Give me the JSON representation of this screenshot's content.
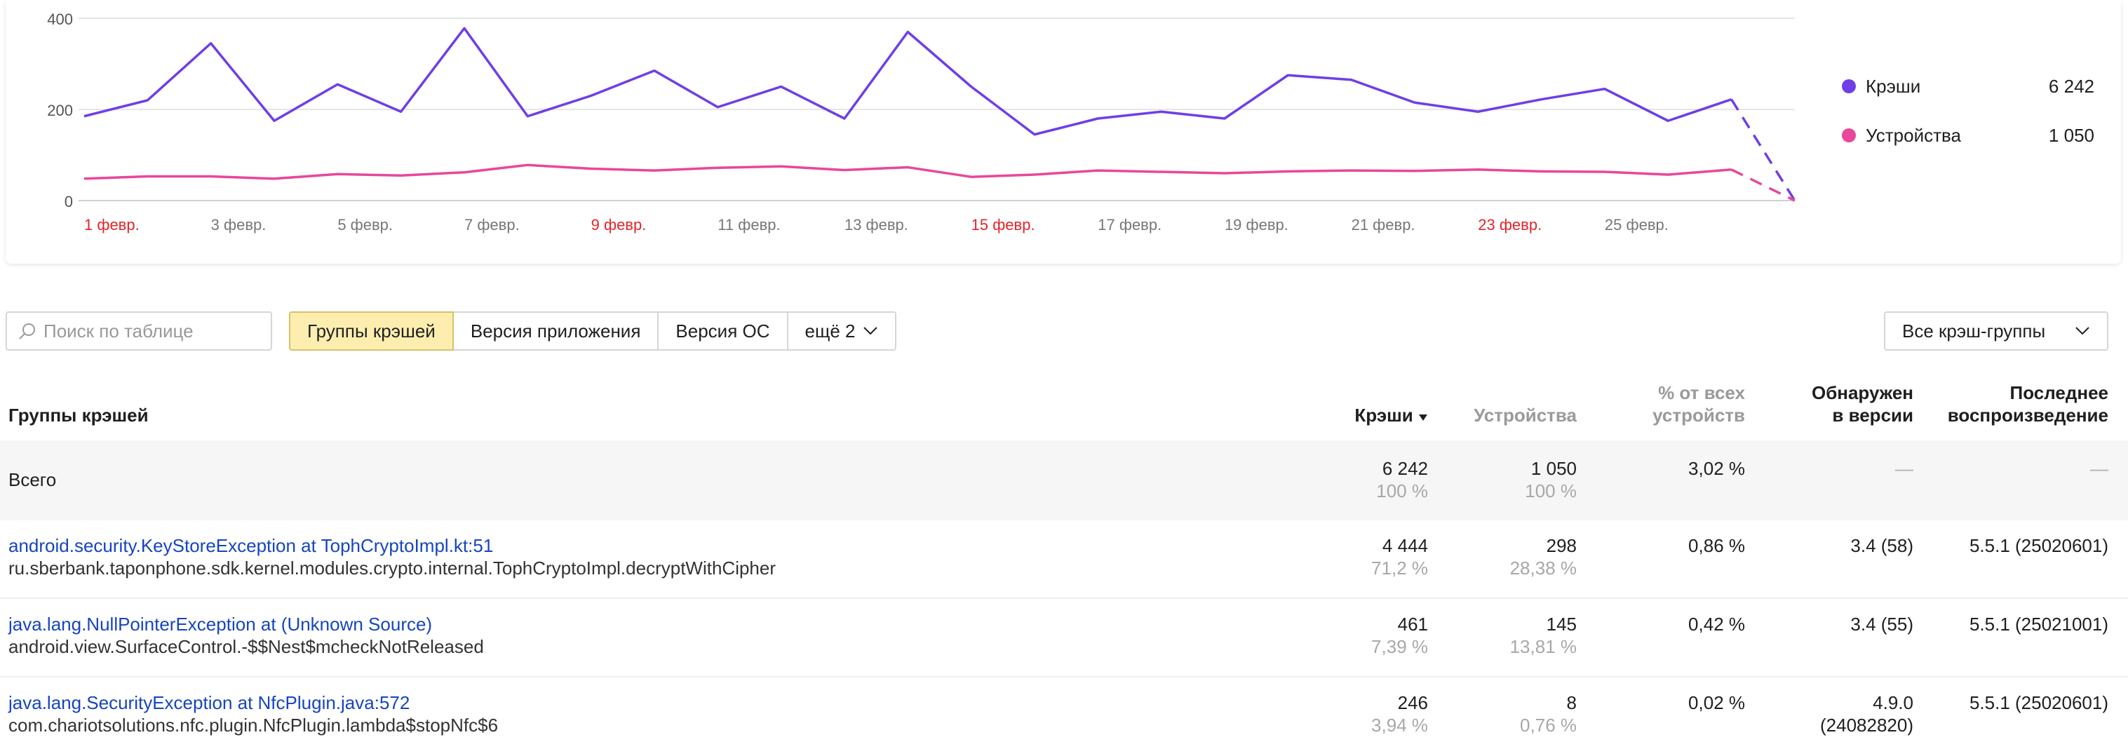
{
  "chart_data": {
    "type": "line",
    "x": [
      "1 февр.",
      "2 февр.",
      "3 февр.",
      "4 февр.",
      "5 февр.",
      "6 февр.",
      "7 февр.",
      "8 февр.",
      "9 февр.",
      "10 февр.",
      "11 февр.",
      "12 февр.",
      "13 февр.",
      "14 февр.",
      "15 февр.",
      "16 февр.",
      "17 февр.",
      "18 февр.",
      "19 февр.",
      "20 февр.",
      "21 февр.",
      "22 февр.",
      "23 февр.",
      "24 февр.",
      "25 февр.",
      "26 февр.",
      "27 февр.",
      "28 февр."
    ],
    "x_tick_labels": [
      {
        "label": "1 февр.",
        "weekend": true
      },
      {
        "label": "3 февр.",
        "weekend": false
      },
      {
        "label": "5 февр.",
        "weekend": false
      },
      {
        "label": "7 февр.",
        "weekend": false
      },
      {
        "label": "9 февр.",
        "weekend": true
      },
      {
        "label": "11 февр.",
        "weekend": false
      },
      {
        "label": "13 февр.",
        "weekend": false
      },
      {
        "label": "15 февр.",
        "weekend": true
      },
      {
        "label": "17 февр.",
        "weekend": false
      },
      {
        "label": "19 февр.",
        "weekend": false
      },
      {
        "label": "21 февр.",
        "weekend": false
      },
      {
        "label": "23 февр.",
        "weekend": true
      },
      {
        "label": "25 февр.",
        "weekend": false
      }
    ],
    "y_ticks": [
      "0",
      "200",
      "400"
    ],
    "ylim": [
      0,
      400
    ],
    "grid": true,
    "series": [
      {
        "name": "Крэши",
        "color": "#6e3fe6",
        "values": [
          185,
          220,
          345,
          175,
          255,
          195,
          378,
          185,
          230,
          285,
          205,
          250,
          180,
          370,
          250,
          145,
          180,
          195,
          180,
          275,
          265,
          215,
          195,
          222,
          245,
          175,
          222,
          0
        ]
      },
      {
        "name": "Устройства",
        "color": "#e8479a",
        "values": [
          48,
          53,
          53,
          48,
          58,
          55,
          62,
          78,
          70,
          66,
          72,
          75,
          67,
          73,
          52,
          57,
          66,
          63,
          60,
          64,
          66,
          65,
          68,
          64,
          63,
          57,
          68,
          0
        ]
      }
    ],
    "last_point_dashed": true,
    "legend_placement": "right"
  },
  "colors": {
    "crashes": "#6e3fe6",
    "devices": "#e8479a",
    "weekend": "#e3242b",
    "link": "#1745bd",
    "active_tab": "#fdeeb0"
  },
  "legend": [
    {
      "label": "Крэши",
      "value": "6 242",
      "color": "#6e3fe6"
    },
    {
      "label": "Устройства",
      "value": "1 050",
      "color": "#e8479a"
    }
  ],
  "toolbar": {
    "search_placeholder": "Поиск по таблице",
    "tabs": [
      "Группы крэшей",
      "Версия приложения",
      "Версия ОС",
      "ещё 2"
    ],
    "active_tab": "Группы крэшей",
    "group_filter": "Все крэш-группы"
  },
  "table": {
    "headers": {
      "group": "Группы крэшей",
      "crashes": "Крэши",
      "devices": "Устройства",
      "percent_line1": "% от всех",
      "percent_line2": "устройств",
      "found_line1": "Обнаружен",
      "found_line2": "в версии",
      "last_line1": "Последнее",
      "last_line2": "воспроизведение"
    },
    "total": {
      "label": "Всего",
      "crashes": "6 242",
      "crashes_pct": "100 %",
      "devices": "1 050",
      "devices_pct": "100 %",
      "percent": "3,02 %",
      "found": "—",
      "last": "—"
    },
    "rows": [
      {
        "title": "android.security.KeyStoreException at TophCryptoImpl.kt:51",
        "subtitle": "ru.sberbank.taponphone.sdk.kernel.modules.crypto.internal.TophCryptoImpl.decryptWithCipher",
        "crashes": "4 444",
        "crashes_pct": "71,2 %",
        "devices": "298",
        "devices_pct": "28,38 %",
        "percent": "0,86 %",
        "found_line1": "3.4 (58)",
        "found_line2": "",
        "last": "5.5.1 (25020601)"
      },
      {
        "title": "java.lang.NullPointerException at (Unknown Source)",
        "subtitle": "android.view.SurfaceControl.-$$Nest$mcheckNotReleased",
        "crashes": "461",
        "crashes_pct": "7,39 %",
        "devices": "145",
        "devices_pct": "13,81 %",
        "percent": "0,42 %",
        "found_line1": "3.4 (55)",
        "found_line2": "",
        "last": "5.5.1 (25021001)"
      },
      {
        "title": "java.lang.SecurityException at NfcPlugin.java:572",
        "subtitle": "com.chariotsolutions.nfc.plugin.NfcPlugin.lambda$stopNfc$6",
        "crashes": "246",
        "crashes_pct": "3,94 %",
        "devices": "8",
        "devices_pct": "0,76 %",
        "percent": "0,02 %",
        "found_line1": "4.9.0",
        "found_line2": "(24082820)",
        "last": "5.5.1 (25020601)"
      }
    ]
  }
}
